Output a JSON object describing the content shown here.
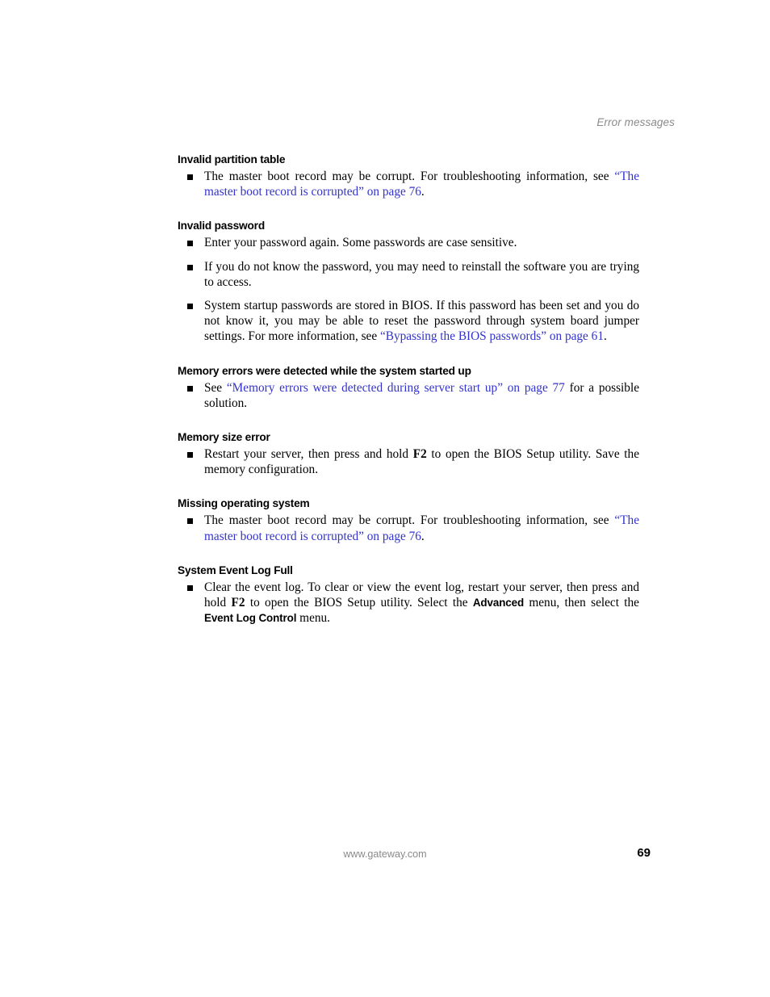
{
  "header": {
    "running_title": "Error messages"
  },
  "sections": [
    {
      "id": "invalid-partition-table",
      "heading": "Invalid partition table",
      "bullets": [
        {
          "parts": [
            {
              "type": "text",
              "text": "The master boot record may be corrupt. For troubleshooting information, see "
            },
            {
              "type": "link",
              "text": "“The master boot record is corrupted” on page 76"
            },
            {
              "type": "text",
              "text": "."
            }
          ]
        }
      ]
    },
    {
      "id": "invalid-password",
      "heading": "Invalid password",
      "bullets": [
        {
          "parts": [
            {
              "type": "text",
              "text": "Enter your password again. Some passwords are case sensitive."
            }
          ]
        },
        {
          "parts": [
            {
              "type": "text",
              "text": "If you do not know the password, you may need to reinstall the software you are trying to access."
            }
          ]
        },
        {
          "parts": [
            {
              "type": "text",
              "text": "System startup passwords are stored in BIOS. If this password has been set and you do not know it, you may be able to reset the password through system board jumper settings. For more information, see "
            },
            {
              "type": "link",
              "text": "“Bypassing the BIOS passwords” on page 61"
            },
            {
              "type": "text",
              "text": "."
            }
          ]
        }
      ]
    },
    {
      "id": "memory-errors-detected",
      "heading": "Memory errors were detected while the system started up",
      "bullets": [
        {
          "parts": [
            {
              "type": "text",
              "text": "See "
            },
            {
              "type": "link",
              "text": "“Memory errors were detected during server start up” on page 77"
            },
            {
              "type": "text",
              "text": " for a possible solution."
            }
          ]
        }
      ]
    },
    {
      "id": "memory-size-error",
      "heading": "Memory size error",
      "bullets": [
        {
          "parts": [
            {
              "type": "text",
              "text": "Restart your server, then press and hold "
            },
            {
              "type": "kbd",
              "text": "F2"
            },
            {
              "type": "text",
              "text": " to open the BIOS Setup utility. Save the memory configuration."
            }
          ]
        }
      ]
    },
    {
      "id": "missing-operating-system",
      "heading": "Missing operating system",
      "bullets": [
        {
          "parts": [
            {
              "type": "text",
              "text": "The master boot record may be corrupt. For troubleshooting information, see "
            },
            {
              "type": "link",
              "text": "“The master boot record is corrupted” on page 76"
            },
            {
              "type": "text",
              "text": "."
            }
          ]
        }
      ]
    },
    {
      "id": "system-event-log-full",
      "heading": "System Event Log Full",
      "bullets": [
        {
          "parts": [
            {
              "type": "text",
              "text": "Clear the event log. To clear or view the event log, restart your server, then press and hold "
            },
            {
              "type": "kbd",
              "text": "F2"
            },
            {
              "type": "text",
              "text": " to open the BIOS Setup utility. Select the "
            },
            {
              "type": "ui",
              "text": "Advanced"
            },
            {
              "type": "text",
              "text": " menu, then select the "
            },
            {
              "type": "ui",
              "text": "Event Log Control"
            },
            {
              "type": "text",
              "text": " menu."
            }
          ]
        }
      ]
    }
  ],
  "footer": {
    "website": "www.gateway.com",
    "page_number": "69"
  },
  "colors": {
    "link": "#3333cc",
    "muted_text": "#8a8a8a",
    "body_text": "#000000"
  }
}
